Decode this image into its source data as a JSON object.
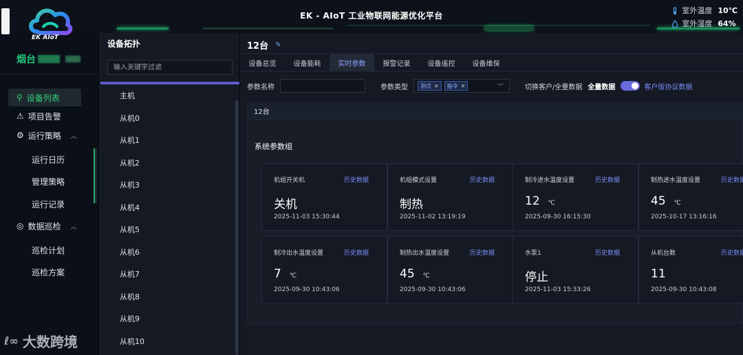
{
  "header": {
    "title": "EK - AIoT 工业物联网能源优化平台",
    "weather": {
      "temp_label": "室外温度",
      "temp_value": "10℃",
      "humidity_label": "室外湿度",
      "humidity_value": "64%"
    }
  },
  "logo": {
    "text": "EK AIoT"
  },
  "sidebar": {
    "site_name": "烟台",
    "items": [
      {
        "label": "设备列表",
        "icon": "device-list-icon",
        "active": true
      },
      {
        "label": "项目告警",
        "icon": "alarm-icon"
      },
      {
        "label": "运行策略",
        "icon": "strategy-icon",
        "expanded": true
      },
      {
        "label": "运行日历",
        "sub": true
      },
      {
        "label": "管理策略",
        "sub": true
      },
      {
        "label": "运行记录",
        "sub": true
      },
      {
        "label": "数据巡检",
        "icon": "inspection-icon",
        "expanded": true
      },
      {
        "label": "巡检计划",
        "sub": true
      },
      {
        "label": "巡检方案",
        "sub": true
      }
    ],
    "watermark": "大数跨境"
  },
  "topology": {
    "title": "设备拓扑",
    "search_placeholder": "输入关键字过滤",
    "items": [
      "主机",
      "从机0",
      "从机1",
      "从机2",
      "从机3",
      "从机4",
      "从机5",
      "从机6",
      "从机7",
      "从机8",
      "从机9",
      "从机10"
    ]
  },
  "main": {
    "title": "12台",
    "tabs": [
      "设备总览",
      "设备能耗",
      "实时参数",
      "报警记录",
      "设备遥控",
      "设备维保"
    ],
    "active_tab": "实时参数",
    "filters": {
      "param_name_label": "参数名称",
      "param_type_label": "参数类型",
      "tags": [
        "测点",
        "指令"
      ],
      "switch_label": "切换客户/全量数据",
      "full_label": "全量数据",
      "client_label": "客户版协议数据"
    },
    "group_label": "12台",
    "section_title": "系统参数组",
    "history_label": "历史数据",
    "cards": [
      {
        "name": "机组开关机",
        "value": "关机",
        "unit": "",
        "time": "2025-11-03 15:30:44"
      },
      {
        "name": "机组模式设置",
        "value": "制热",
        "unit": "",
        "time": "2025-11-02 13:19:19"
      },
      {
        "name": "制冷进水温度设置",
        "value": "12",
        "unit": "℃",
        "time": "2025-09-30 16:15:30"
      },
      {
        "name": "制热进水温度设置",
        "value": "45",
        "unit": "℃",
        "time": "2025-10-17 13:16:16"
      },
      {
        "name": "制冷出水温度设置",
        "value": "7",
        "unit": "℃",
        "time": "2025-09-30 10:43:06"
      },
      {
        "name": "制热出水温度设置",
        "value": "45",
        "unit": "℃",
        "time": "2025-09-30 10:43:06"
      },
      {
        "name": "水泵1",
        "value": "停止",
        "unit": "",
        "time": "2025-11-03 15:33:26"
      },
      {
        "name": "从机台数",
        "value": "11",
        "unit": "",
        "time": "2025-09-30 10:43:08"
      }
    ]
  }
}
